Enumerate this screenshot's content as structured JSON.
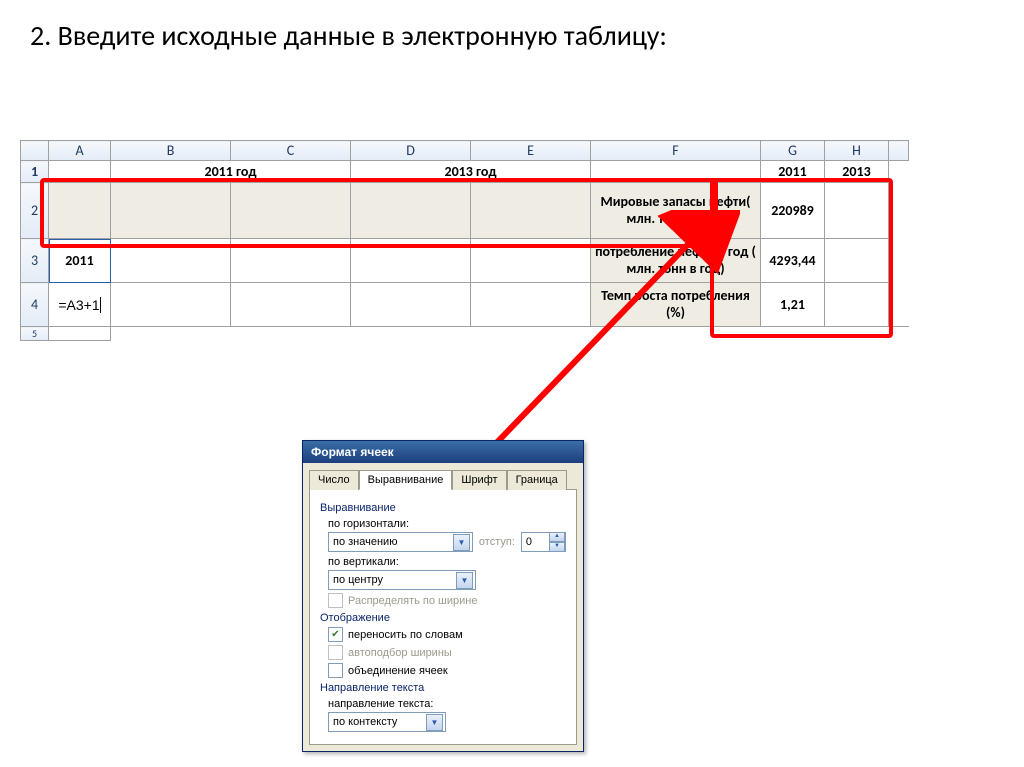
{
  "title": "2. Введите исходные данные в электронную таблицу:",
  "columns": [
    "A",
    "B",
    "C",
    "D",
    "E",
    "F",
    "G",
    "H"
  ],
  "row1": {
    "BC": "2011 год",
    "DE": "2013 год",
    "G": "2011",
    "H": "2013"
  },
  "rowsF": {
    "f2": "Мировые запасы нефти( млн. тонн в год)",
    "f3": "потребление нефти в год ( млн. тонн в год)",
    "f4": "Темп роста потребления (%)"
  },
  "rowsG": {
    "g2": "220989",
    "g3": "4293,44",
    "g4": "1,21"
  },
  "a3": "2011",
  "a4": "=A3+1",
  "dialog": {
    "title": "Формат ячеек",
    "tabs": [
      "Число",
      "Выравнивание",
      "Шрифт",
      "Граница"
    ],
    "grp_align": "Выравнивание",
    "lbl_horiz": "по горизонтали:",
    "val_horiz": "по значению",
    "lbl_indent": "отступ:",
    "val_indent": "0",
    "lbl_vert": "по вертикали:",
    "val_vert": "по центру",
    "chk_distribute": "Распределять по ширине",
    "grp_display": "Отображение",
    "chk_wrap": "переносить по словам",
    "chk_autofit": "автоподбор ширины",
    "chk_merge": "объединение ячеек",
    "grp_direction": "Направление текста",
    "lbl_direction": "направление текста:",
    "val_direction": "по контексту"
  }
}
